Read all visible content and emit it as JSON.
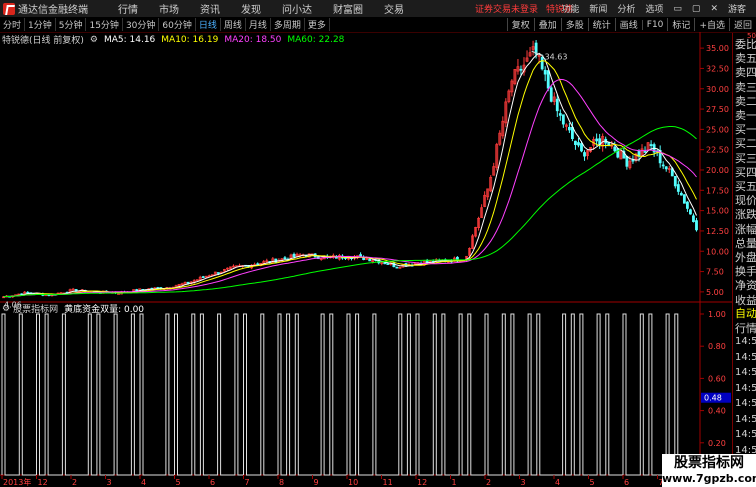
{
  "app": {
    "title": "通达信金融终端",
    "menu": [
      "行情",
      "市场",
      "资讯",
      "发现",
      "问小达",
      "财富圈",
      "交易"
    ],
    "login_tip": "证券交易未登录",
    "stock_tip": "特锐德",
    "right_menu": [
      "功能",
      "新闻",
      "分析",
      "选项"
    ],
    "user": "游客"
  },
  "toolbar": {
    "periods": [
      "分时",
      "1分钟",
      "5分钟",
      "15分钟",
      "30分钟",
      "60分钟",
      "日线",
      "周线",
      "月线",
      "多周期",
      "更多"
    ],
    "active": "日线",
    "right_buttons": [
      "复权",
      "叠加",
      "多股",
      "统计",
      "画线",
      "F10",
      "标记",
      "+自选",
      "返回"
    ]
  },
  "main_chart": {
    "title": "特锐德(日线 前复权)",
    "ma": [
      {
        "label": "MA5: 14.16",
        "color": "#ffffff"
      },
      {
        "label": "MA10: 16.19",
        "color": "#ffff00"
      },
      {
        "label": "MA20: 18.50",
        "color": "#ff40ff"
      },
      {
        "label": "MA60: 22.28",
        "color": "#00ff00"
      }
    ],
    "y_ticks": [
      "35.00",
      "32.50",
      "30.00",
      "27.50",
      "25.00",
      "22.50",
      "20.00",
      "17.50",
      "15.00",
      "12.50",
      "10.00",
      "7.50",
      "5.00"
    ],
    "high_label": "34.63",
    "low_label": "4.06"
  },
  "sub_chart": {
    "title": "股票指标网",
    "indicator": "黄底资金双量: 0.00",
    "y_ticks": [
      "1.00",
      "0.80",
      "0.60",
      "0.40",
      "0.20"
    ],
    "current_value": "0.48"
  },
  "x_axis": [
    "2013年",
    "12",
    "2",
    "3",
    "4",
    "5",
    "6",
    "7",
    "8",
    "9",
    "10",
    "11",
    "12",
    "1",
    "2",
    "3",
    "4",
    "5",
    "6",
    "7",
    "8"
  ],
  "right_panel": {
    "top_tag": "500",
    "items": [
      "委比",
      "卖五",
      "卖四",
      "卖三",
      "卖二",
      "卖一",
      "买一",
      "买二",
      "买三",
      "买四",
      "买五",
      "现价",
      "涨跌",
      "涨幅",
      "总量",
      "外盘",
      "换手",
      "净资",
      "收益"
    ],
    "tick_header": "自动",
    "tick_sub": "行情",
    "ticks": [
      "14:56",
      "14:56",
      "14:56",
      "14:56",
      "14:56",
      "14:56",
      "14:56",
      "14:56",
      "14:56"
    ]
  },
  "watermark": {
    "line1": "股票指标网",
    "line2": "www.7gpzb.com"
  },
  "colors": {
    "up": "#ff3c3c",
    "down": "#54ffff",
    "ma5": "#ffffff",
    "ma10": "#ffff00",
    "ma20": "#ff40ff",
    "ma60": "#00ff00",
    "axis": "#a00000"
  },
  "chart_data": {
    "type": "line",
    "title": "特锐德(日线 前复权)",
    "ylim": [
      4.0,
      36.0
    ],
    "price_path": [
      4.4,
      4.9,
      4.6,
      5.2,
      5.0,
      4.9,
      5.3,
      5.5,
      6.1,
      7.2,
      8.0,
      8.5,
      9.0,
      9.6,
      9.2,
      9.4,
      9.0,
      8.2,
      8.6,
      8.8,
      9.1,
      18.0,
      31.0,
      34.6,
      27.0,
      22.0,
      24.0,
      21.0,
      23.0,
      19.0,
      13.0
    ],
    "sub_bars": [
      1,
      0,
      1,
      0,
      1,
      1,
      0,
      1,
      0,
      0,
      1,
      1,
      0,
      1,
      0,
      1,
      1,
      0,
      0,
      1,
      1,
      0,
      1,
      1,
      0,
      1,
      0,
      1,
      1,
      0,
      1,
      0,
      1,
      1,
      1,
      0,
      0,
      1,
      1,
      0,
      1,
      1,
      0,
      1,
      0,
      0,
      1,
      1,
      1,
      0,
      1,
      1,
      0,
      1,
      1,
      0,
      1,
      0,
      1,
      1,
      0,
      1,
      1,
      0,
      0,
      1,
      1,
      1,
      0,
      1,
      1,
      0,
      1,
      0,
      1,
      1,
      0,
      1,
      1,
      0
    ]
  }
}
